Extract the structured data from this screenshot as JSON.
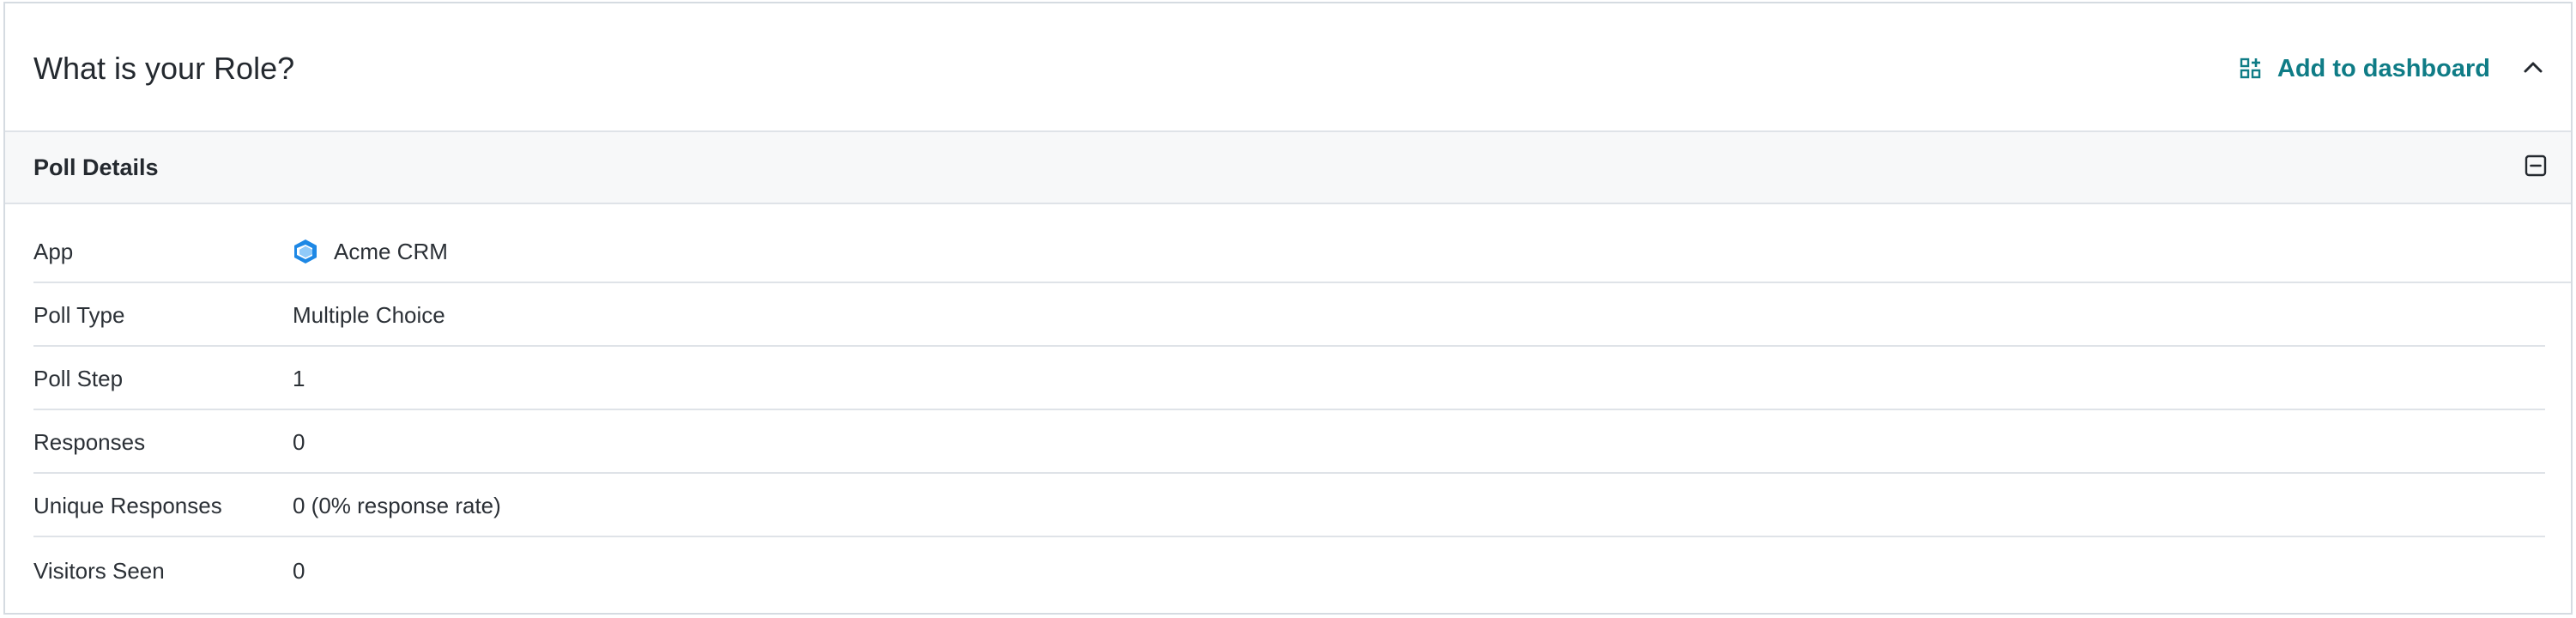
{
  "header": {
    "title": "What is your Role?",
    "add_to_dashboard_label": "Add to dashboard",
    "accent_color": "#0f7c86"
  },
  "section": {
    "title": "Poll Details"
  },
  "details": [
    {
      "label": "App",
      "value": "Acme CRM",
      "icon": "app-logo-icon"
    },
    {
      "label": "Poll Type",
      "value": "Multiple Choice"
    },
    {
      "label": "Poll Step",
      "value": "1"
    },
    {
      "label": "Responses",
      "value": "0"
    },
    {
      "label": "Unique Responses",
      "value": "0 (0% response rate)"
    },
    {
      "label": "Visitors Seen",
      "value": "0"
    }
  ]
}
